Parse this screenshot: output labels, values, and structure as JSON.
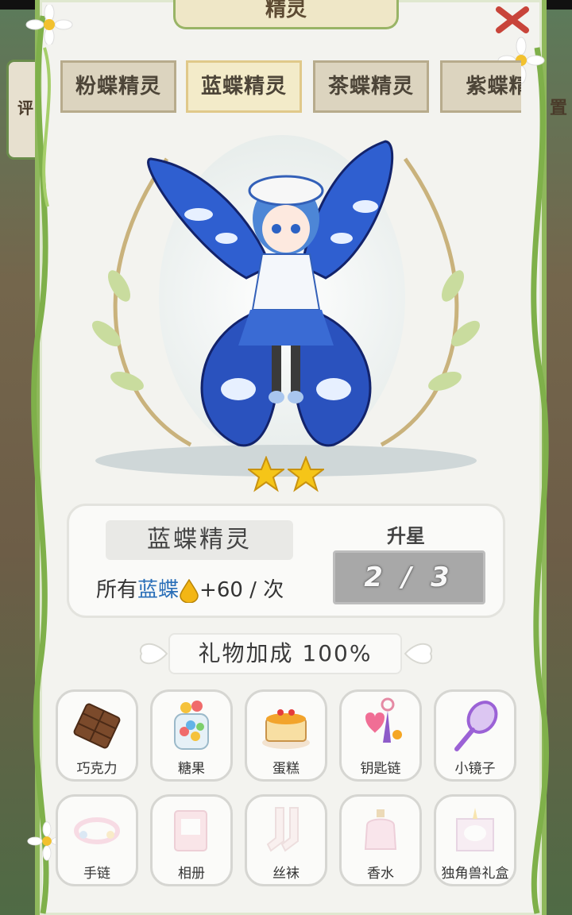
{
  "panel": {
    "title": "精灵"
  },
  "background": {
    "left_text": "评",
    "right_text": "置"
  },
  "tabs": [
    {
      "label": "粉蝶精灵",
      "active": false
    },
    {
      "label": "蓝蝶精灵",
      "active": true
    },
    {
      "label": "茶蝶精灵",
      "active": false
    },
    {
      "label": "紫蝶精",
      "active": false
    }
  ],
  "fairy": {
    "stars": 2,
    "name": "蓝蝶精灵"
  },
  "bonus": {
    "prefix": "所有",
    "highlight": "蓝蝶",
    "value": "+60 / 次"
  },
  "upgrade": {
    "label": "升星",
    "progress": "2 / 3"
  },
  "gift_bonus": "礼物加成 100%",
  "gifts": [
    {
      "label": "巧克力",
      "icon": "chocolate-icon",
      "locked": false
    },
    {
      "label": "糖果",
      "icon": "candy-jar-icon",
      "locked": false
    },
    {
      "label": "蛋糕",
      "icon": "cake-icon",
      "locked": false
    },
    {
      "label": "钥匙链",
      "icon": "keychain-icon",
      "locked": false
    },
    {
      "label": "小镜子",
      "icon": "hand-mirror-icon",
      "locked": false
    },
    {
      "label": "手链",
      "icon": "bracelet-icon",
      "locked": true
    },
    {
      "label": "相册",
      "icon": "photo-album-icon",
      "locked": true
    },
    {
      "label": "丝袜",
      "icon": "stockings-icon",
      "locked": true
    },
    {
      "label": "香水",
      "icon": "perfume-icon",
      "locked": true
    },
    {
      "label": "独角兽礼盒",
      "icon": "unicorn-gift-box-icon",
      "locked": true
    }
  ],
  "colors": {
    "vine": "#7fb04a",
    "star": "#f5c518",
    "wing_blue": "#2a52be",
    "active_tab": "#f3ebc9"
  }
}
